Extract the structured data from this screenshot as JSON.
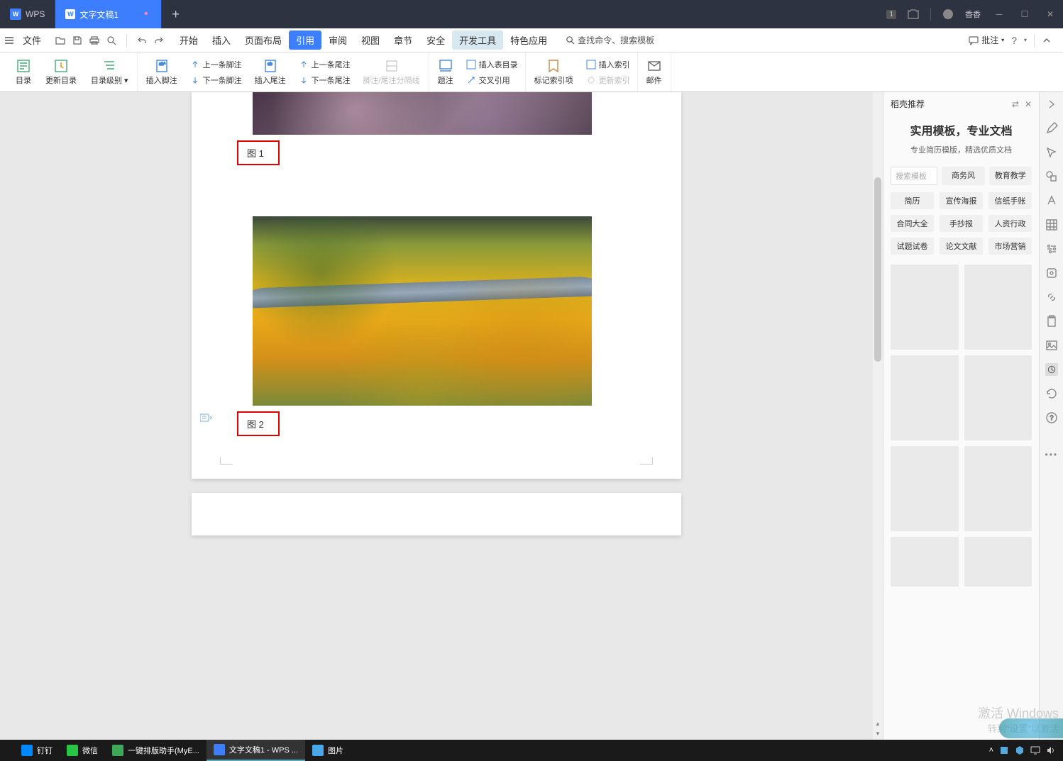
{
  "title_bar": {
    "app_name": "WPS",
    "doc_tab": "文字文稿1",
    "user_name": "香香",
    "badge": "1"
  },
  "menu": {
    "file": "文件",
    "items": [
      "开始",
      "插入",
      "页面布局",
      "引用",
      "审阅",
      "视图",
      "章节",
      "安全",
      "开发工具",
      "特色应用"
    ],
    "active_index": 3,
    "highlight_index": 8,
    "search_cmd": "查找命令、搜索模板",
    "annotate": "批注"
  },
  "ribbon": {
    "toc": "目录",
    "update_toc": "更新目录",
    "toc_level": "目录级别",
    "insert_footnote": "插入脚注",
    "prev_footnote": "上一条脚注",
    "next_footnote": "下一条脚注",
    "insert_endnote": "插入尾注",
    "prev_endnote": "上一条尾注",
    "next_endnote": "下一条尾注",
    "separator": "脚注/尾注分隔线",
    "caption": "题注",
    "insert_toc_fig": "插入表目录",
    "cross_ref": "交叉引用",
    "mark_index": "标记索引项",
    "insert_index": "插入索引",
    "update_index": "更新索引",
    "mail": "邮件"
  },
  "doc": {
    "caption1": "图  1",
    "caption2": "图  2"
  },
  "panel": {
    "header": "稻壳推荐",
    "title": "实用模板，专业文档",
    "subtitle": "专业简历模版，精选优质文档",
    "search_placeholder": "搜索模板",
    "tabs": [
      "商务风",
      "教育教学"
    ],
    "tags": [
      [
        "简历",
        "宣传海报",
        "信纸手账"
      ],
      [
        "合同大全",
        "手抄报",
        "人资行政"
      ],
      [
        "试题试卷",
        "论文文献",
        "市场营销"
      ]
    ]
  },
  "watermark": {
    "line1": "激活 Windows",
    "line2": "转到\"设置\"以激活"
  },
  "taskbar": {
    "items": [
      {
        "label": "钉钉",
        "color": "#0089ff"
      },
      {
        "label": "微信",
        "color": "#28c445"
      },
      {
        "label": "一键排版助手(MyE...",
        "color": "#3da858"
      },
      {
        "label": "文字文稿1 - WPS ...",
        "color": "#3d7eff"
      },
      {
        "label": "图片",
        "color": "#4aa8e8"
      }
    ]
  }
}
